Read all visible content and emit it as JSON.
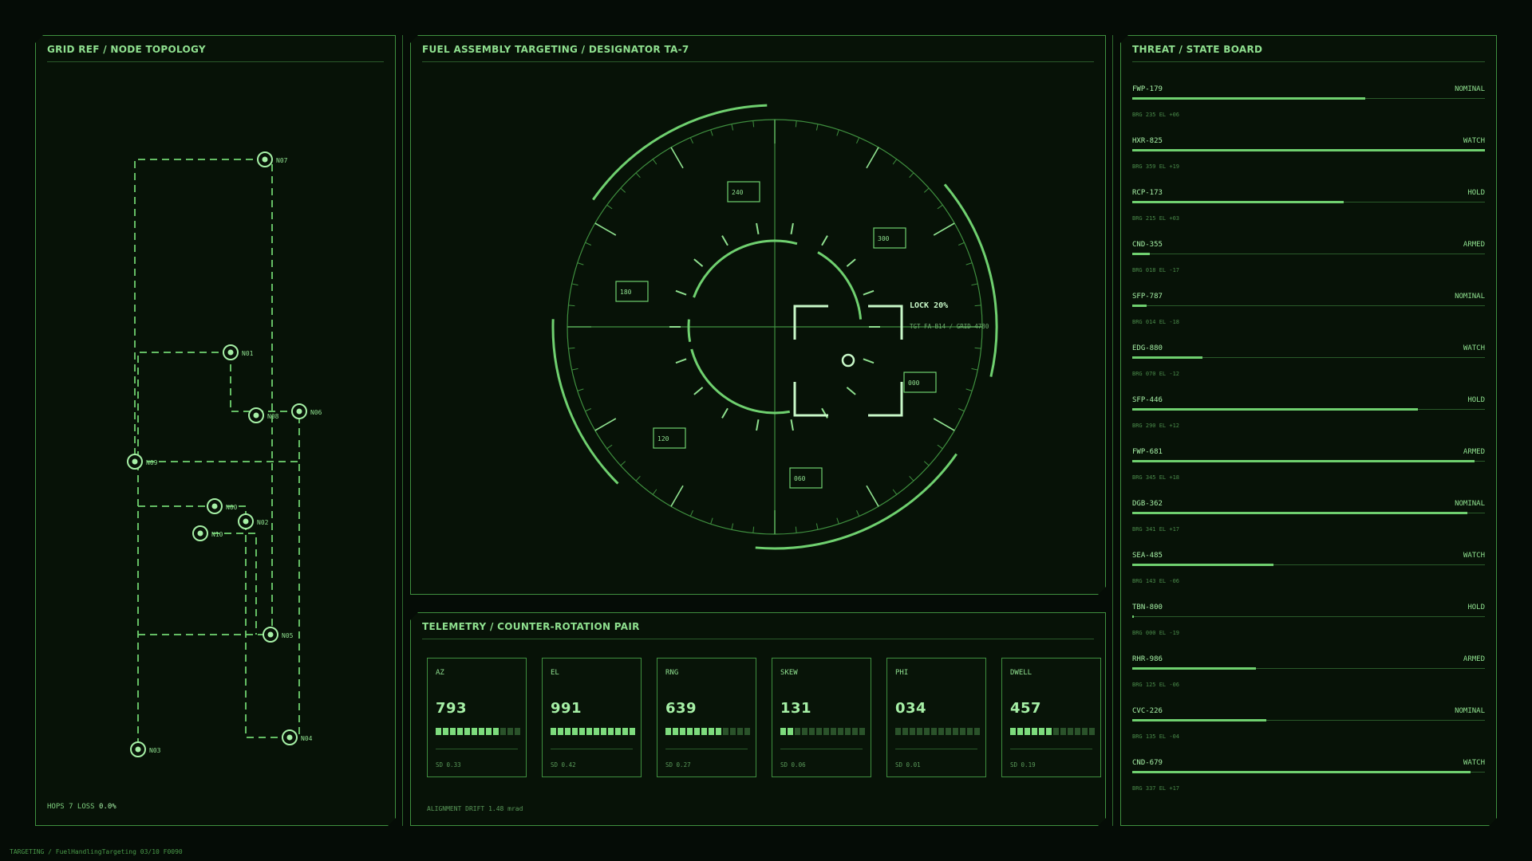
{
  "topology": {
    "title": "GRID REF / NODE TOPOLOGY",
    "footer_label": "HOPS 7  LOSS",
    "footer_value": "0.0%",
    "nodes": [
      "N07",
      "N01",
      "N08",
      "N06",
      "N09",
      "N00",
      "N02",
      "N10",
      "N05",
      "N04",
      "N03"
    ]
  },
  "targeting": {
    "title": "FUEL ASSEMBLY TARGETING / DESIGNATOR TA-7",
    "lock_label": "LOCK 20%",
    "target_label": "TGT FA-B14 / GRID 4780",
    "bearing_labels": [
      "240",
      "300",
      "180",
      "000",
      "120",
      "060"
    ]
  },
  "telemetry": {
    "title": "TELEMETRY / COUNTER-ROTATION PAIR",
    "footnote": "ALIGNMENT DRIFT 1.48 mrad",
    "cards": [
      {
        "label": "AZ",
        "value": "793",
        "sd": "SD 0.33",
        "level": 0.79
      },
      {
        "label": "EL",
        "value": "991",
        "sd": "SD 0.42",
        "level": 0.99
      },
      {
        "label": "RNG",
        "value": "639",
        "sd": "SD 0.27",
        "level": 0.64
      },
      {
        "label": "SKEW",
        "value": "131",
        "sd": "SD 0.06",
        "level": 0.13
      },
      {
        "label": "PHI",
        "value": "034",
        "sd": "SD 0.01",
        "level": 0.03
      },
      {
        "label": "DWELL",
        "value": "457",
        "sd": "SD 0.19",
        "level": 0.46
      }
    ]
  },
  "threats": {
    "title": "THREAT / STATE BOARD",
    "rows": [
      {
        "id": "FWP-179",
        "state": "NOMINAL",
        "sub": "BRG 235  EL +06",
        "level": 0.66
      },
      {
        "id": "HXR-825",
        "state": "WATCH",
        "sub": "BRG 359  EL +19",
        "level": 1.0
      },
      {
        "id": "RCP-173",
        "state": "HOLD",
        "sub": "BRG 215  EL +03",
        "level": 0.6
      },
      {
        "id": "CND-355",
        "state": "ARMED",
        "sub": "BRG 018  EL -17",
        "level": 0.05
      },
      {
        "id": "SFP-787",
        "state": "NOMINAL",
        "sub": "BRG 014  EL -18",
        "level": 0.04
      },
      {
        "id": "EDG-880",
        "state": "WATCH",
        "sub": "BRG 070  EL -12",
        "level": 0.2
      },
      {
        "id": "SFP-446",
        "state": "HOLD",
        "sub": "BRG 290  EL +12",
        "level": 0.81
      },
      {
        "id": "FWP-681",
        "state": "ARMED",
        "sub": "BRG 345  EL +18",
        "level": 0.97
      },
      {
        "id": "DGB-362",
        "state": "NOMINAL",
        "sub": "BRG 341  EL +17",
        "level": 0.95
      },
      {
        "id": "SEA-485",
        "state": "WATCH",
        "sub": "BRG 143  EL -06",
        "level": 0.4
      },
      {
        "id": "TBN-800",
        "state": "HOLD",
        "sub": "BRG 000  EL -19",
        "level": 0.005
      },
      {
        "id": "RHR-986",
        "state": "ARMED",
        "sub": "BRG 125  EL -06",
        "level": 0.35
      },
      {
        "id": "CVC-226",
        "state": "NOMINAL",
        "sub": "BRG 135  EL -04",
        "level": 0.38
      },
      {
        "id": "CND-679",
        "state": "WATCH",
        "sub": "BRG 337  EL +17",
        "level": 0.96
      }
    ]
  },
  "status_bar": "TARGETING / FuelHandlingTargeting 03/10 F0090"
}
